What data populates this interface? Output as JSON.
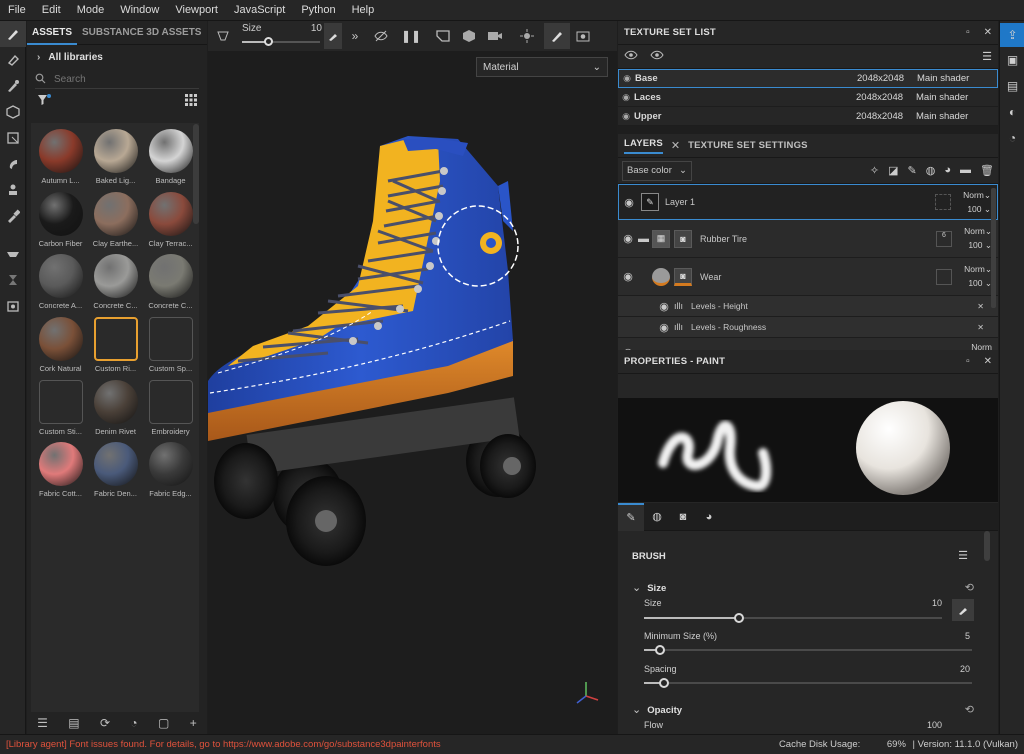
{
  "menu": [
    "File",
    "Edit",
    "Mode",
    "Window",
    "Viewport",
    "JavaScript",
    "Python",
    "Help"
  ],
  "assets": {
    "tab_assets": "ASSETS",
    "tab_substance": "SUBSTANCE 3D ASSETS",
    "all_libraries": "All libraries",
    "search_placeholder": "Search",
    "items": [
      {
        "label": "Autumn L...",
        "color": "#8a3a2a"
      },
      {
        "label": "Baked Lig...",
        "color": "#b8a894"
      },
      {
        "label": "Bandage",
        "color": "#d4d4d4"
      },
      {
        "label": "Carbon Fiber",
        "color": "#1a1a1a"
      },
      {
        "label": "Clay Earthe...",
        "color": "#8c6e5e"
      },
      {
        "label": "Clay Terrac...",
        "color": "#8a4a3c"
      },
      {
        "label": "Concrete A...",
        "color": "#5a5a5a"
      },
      {
        "label": "Concrete C...",
        "color": "#9a9a98"
      },
      {
        "label": "Concrete C...",
        "color": "#7a7a72"
      },
      {
        "label": "Cork Natural",
        "color": "#7a5038"
      },
      {
        "label": "Custom Ri...",
        "color": "#e8a030"
      },
      {
        "label": "Custom Sp...",
        "color": "#e8e8e8"
      },
      {
        "label": "Custom Sti...",
        "color": "#e8e8e8"
      },
      {
        "label": "Denim Rivet",
        "color": "#4a4038"
      },
      {
        "label": "Embroidery",
        "color": "#e8e8e8"
      },
      {
        "label": "Fabric Cott...",
        "color": "#e07a7a"
      },
      {
        "label": "Fabric Den...",
        "color": "#4a5a7a"
      },
      {
        "label": "Fabric Edg...",
        "color": "#3a3a3a"
      }
    ]
  },
  "viewport": {
    "size_label": "Size",
    "size_value": "10",
    "material_select": "Material"
  },
  "texture_set_list": {
    "title": "TEXTURE SET LIST",
    "rows": [
      {
        "name": "Base",
        "res": "2048x2048",
        "shader": "Main shader"
      },
      {
        "name": "Laces",
        "res": "2048x2048",
        "shader": "Main shader"
      },
      {
        "name": "Upper",
        "res": "2048x2048",
        "shader": "Main shader"
      }
    ]
  },
  "layers": {
    "tab_layers": "LAYERS",
    "tab_tss": "TEXTURE SET SETTINGS",
    "channel": "Base color",
    "items": [
      {
        "name": "Layer 1",
        "blend": "Norm",
        "opacity": "100"
      },
      {
        "name": "Rubber Tire",
        "blend": "Norm",
        "opacity": "100",
        "badge": "6"
      },
      {
        "name": "Wear",
        "blend": "Norm",
        "opacity": "100"
      }
    ],
    "effects": [
      {
        "name": "Levels - Height"
      },
      {
        "name": "Levels - Roughness"
      }
    ],
    "partial_blend": "Norm"
  },
  "properties": {
    "title": "PROPERTIES - PAINT",
    "brush_section": "BRUSH",
    "size_section": "Size",
    "size_label": "Size",
    "size_value": "10",
    "size_frac": 0.32,
    "min_size_label": "Minimum Size (%)",
    "min_size_value": "5",
    "min_size_frac": 0.05,
    "spacing_label": "Spacing",
    "spacing_value": "20",
    "spacing_frac": 0.06,
    "opacity_section": "Opacity",
    "flow_label": "Flow",
    "flow_value": "100"
  },
  "status": {
    "message": "[Library agent] Font issues found. For details, go to https://www.adobe.com/go/substance3dpainterfonts",
    "cache": "Cache Disk Usage:",
    "cache_value": "69%",
    "version": "| Version: 11.1.0 (Vulkan)"
  },
  "colors": {
    "accent": "#3a8bd0",
    "boot_blue": "#2a55c8",
    "boot_yellow": "#f2b320",
    "sole_orange": "#d4761f"
  }
}
